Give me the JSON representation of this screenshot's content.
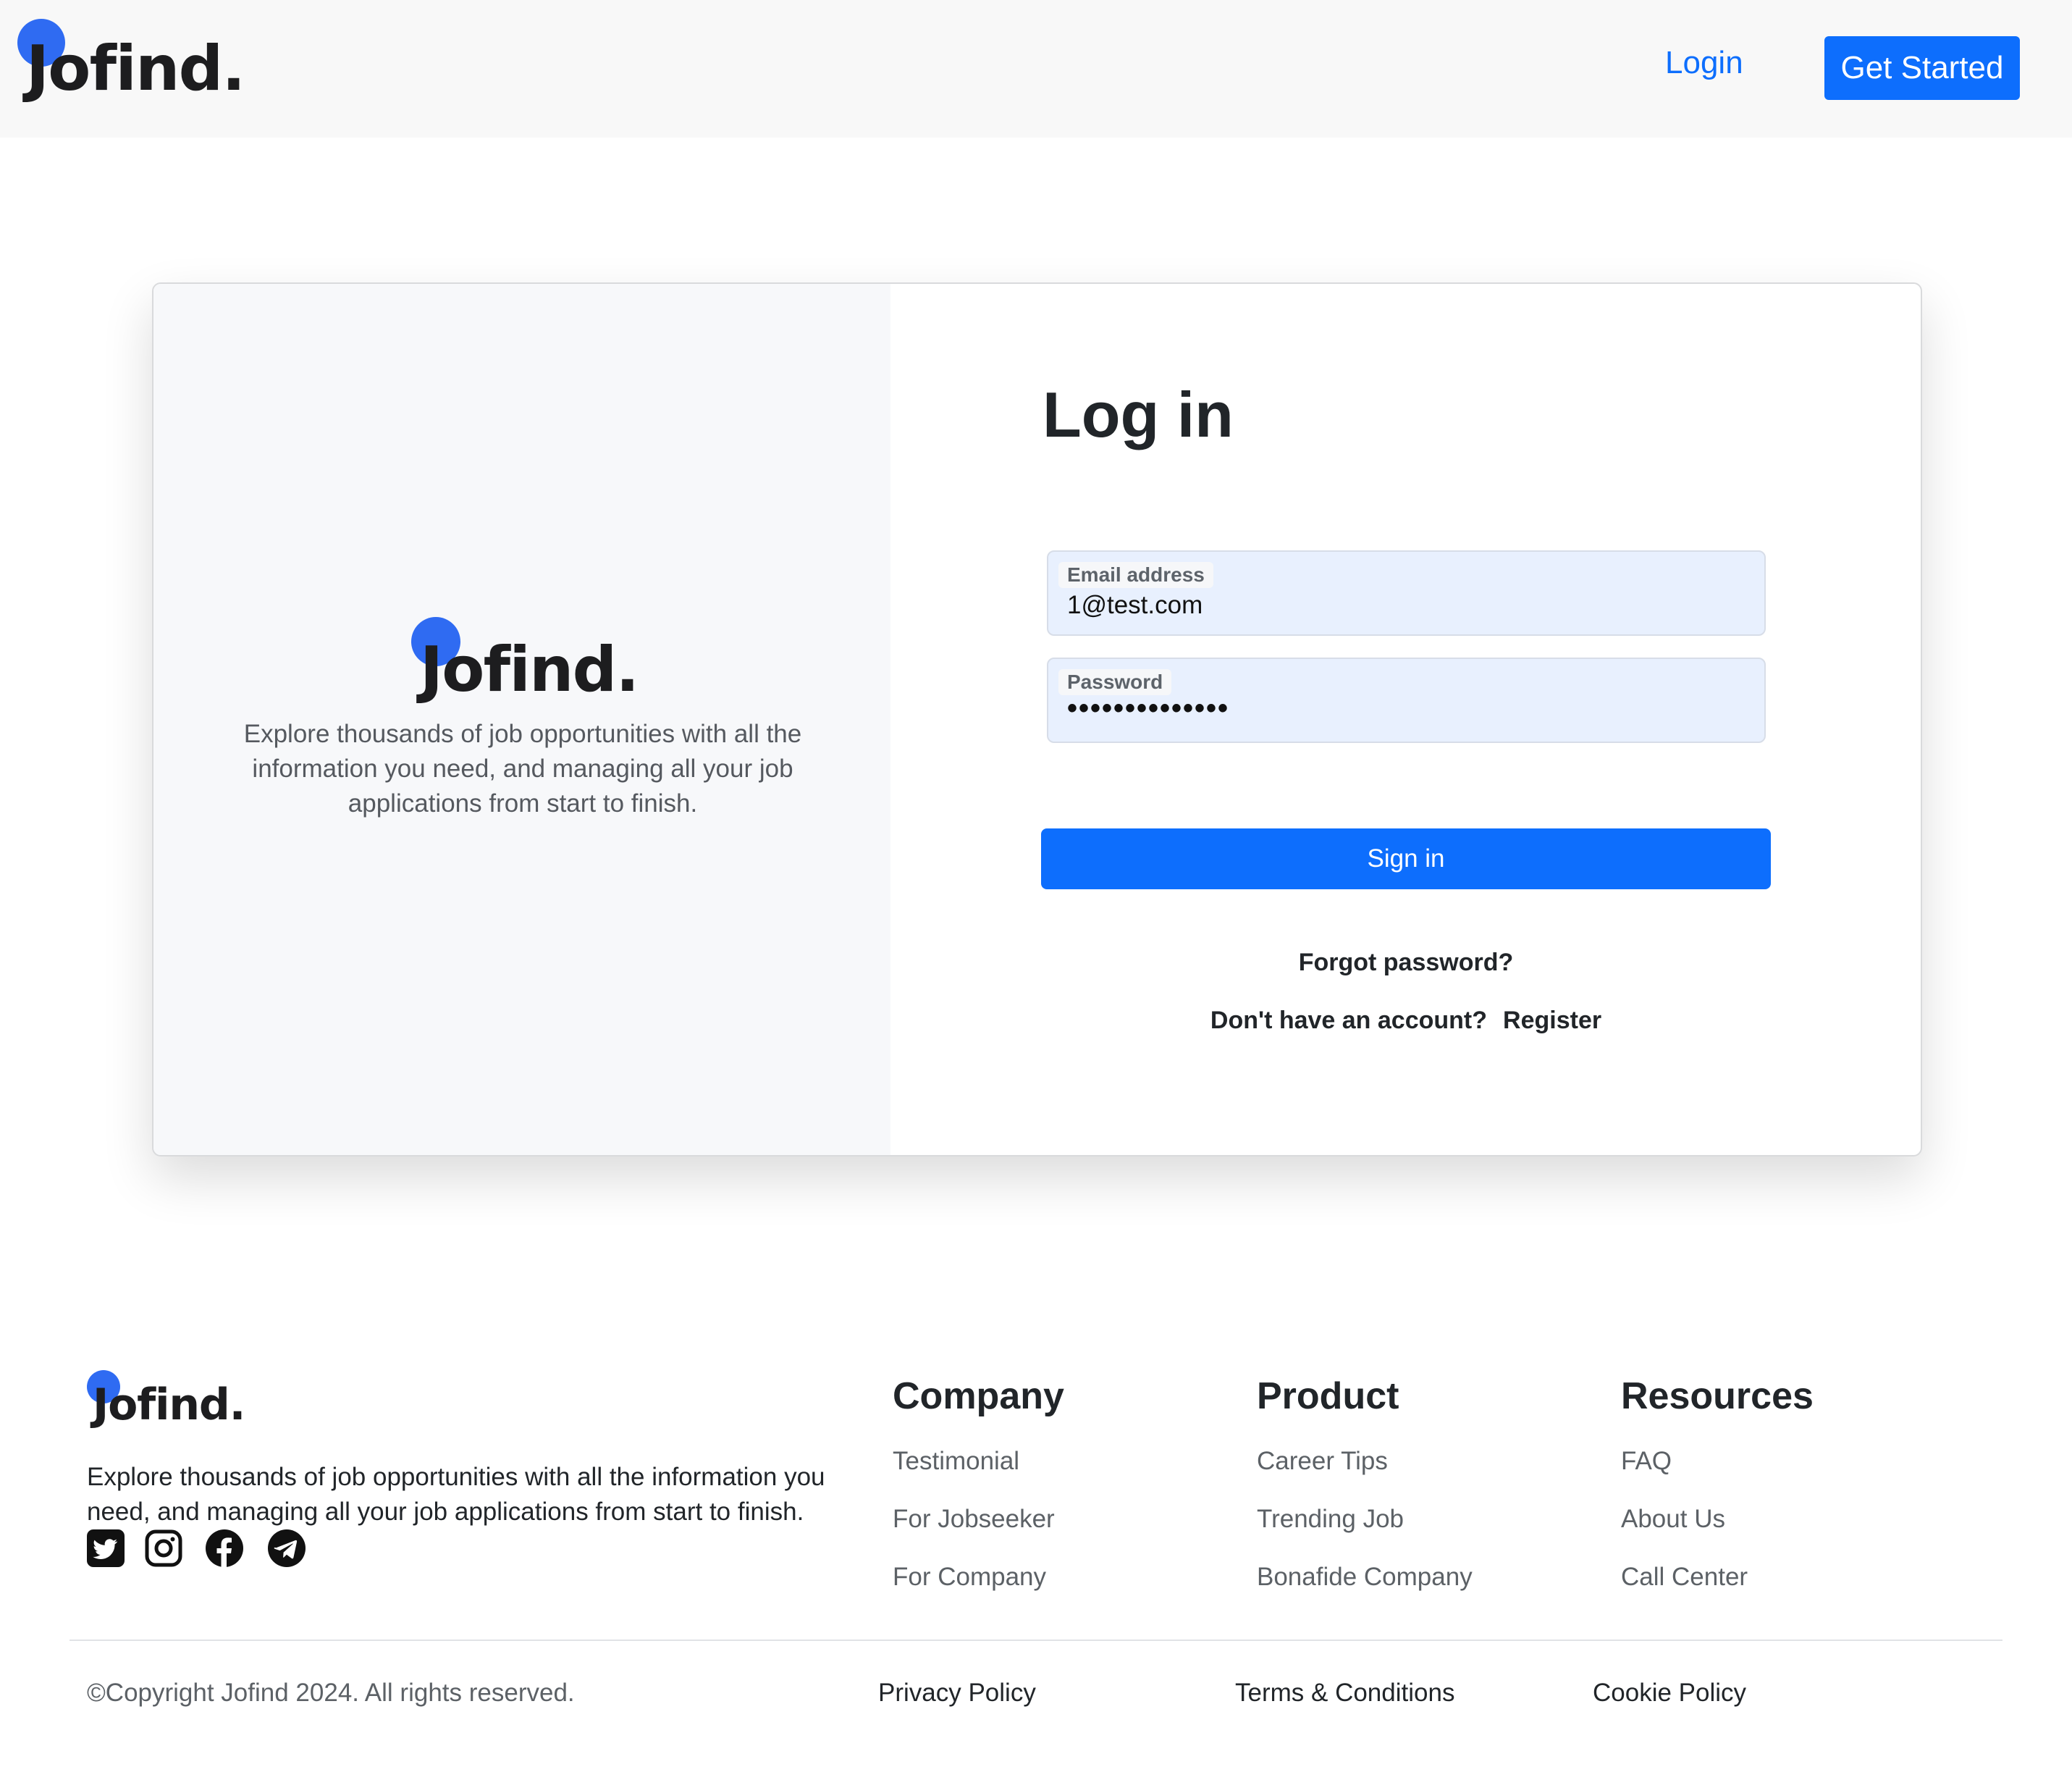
{
  "brand": {
    "name": "Jofind.",
    "accent_color": "#2f6bf2",
    "primary_color": "#0d6efd"
  },
  "header": {
    "login_label": "Login",
    "get_started_label": "Get Started"
  },
  "hero": {
    "tagline": "Explore thousands of job opportunities with all the information you need, and managing all your job applications from start to finish."
  },
  "login_form": {
    "title": "Log in",
    "email_label": "Email address",
    "email_value": "1@test.com",
    "password_label": "Password",
    "password_masked": "••••••••••••••",
    "sign_in_label": "Sign in",
    "forgot_label": "Forgot password?",
    "no_account_label": "Don't have an account?",
    "register_label": "Register"
  },
  "footer": {
    "description": "Explore thousands of job opportunities with all the information you need, and managing all your job applications from start to finish.",
    "social_icons": [
      "twitter-icon",
      "instagram-icon",
      "facebook-icon",
      "telegram-icon"
    ],
    "columns": [
      {
        "title": "Company",
        "links": [
          "Testimonial",
          "For Jobseeker",
          "For Company"
        ]
      },
      {
        "title": "Product",
        "links": [
          "Career Tips",
          "Trending Job",
          "Bonafide Company"
        ]
      },
      {
        "title": "Resources",
        "links": [
          "FAQ",
          "About Us",
          "Call Center"
        ]
      }
    ],
    "copyright": "©Copyright Jofind 2024. All rights reserved.",
    "legal_links": [
      "Privacy Policy",
      "Terms & Conditions",
      "Cookie Policy"
    ]
  }
}
